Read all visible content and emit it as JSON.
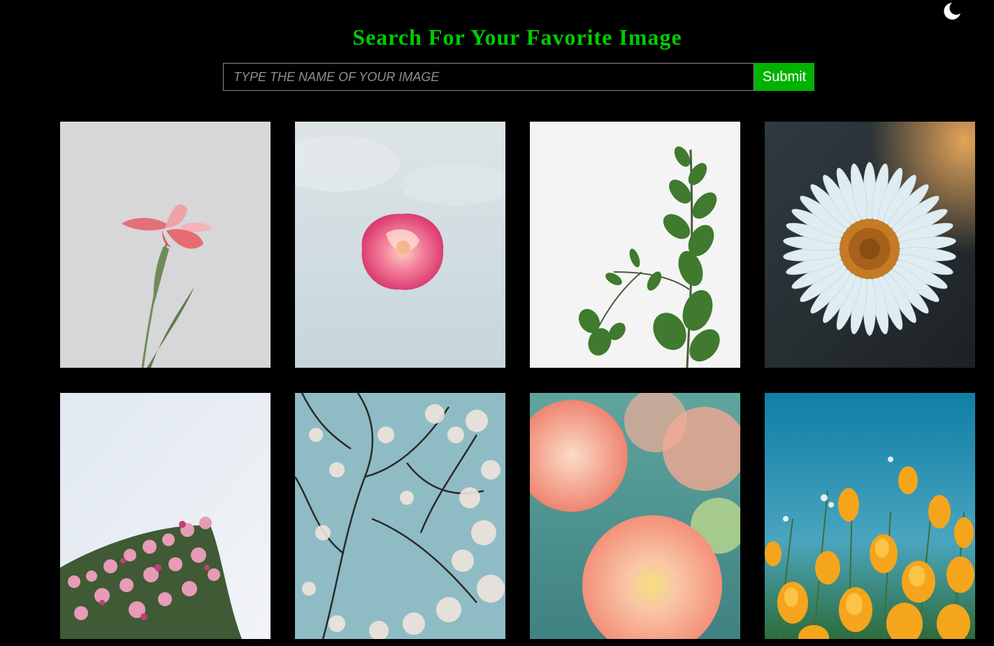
{
  "header": {
    "title": "Search For Your Favorite Image",
    "theme_toggle_icon": "moon-icon"
  },
  "search": {
    "placeholder": "TYPE THE NAME OF YOUR IMAGE",
    "value": "",
    "submit_label": "Submit"
  },
  "colors": {
    "background": "#000000",
    "title": "#00cc00",
    "submit_bg": "#00b300",
    "input_border": "#8a8a8a"
  },
  "gallery": {
    "images": [
      {
        "subject": "pink iris flower on grey background"
      },
      {
        "subject": "pink rose floating against pale sky"
      },
      {
        "subject": "eucalyptus branch on white background"
      },
      {
        "subject": "white daisy with orange center"
      },
      {
        "subject": "pink cherry blossoms against pale sky"
      },
      {
        "subject": "blossoming tree branches against blue sky"
      },
      {
        "subject": "peach dahlias close-up"
      },
      {
        "subject": "orange poppies in a field under blue sky"
      }
    ]
  }
}
